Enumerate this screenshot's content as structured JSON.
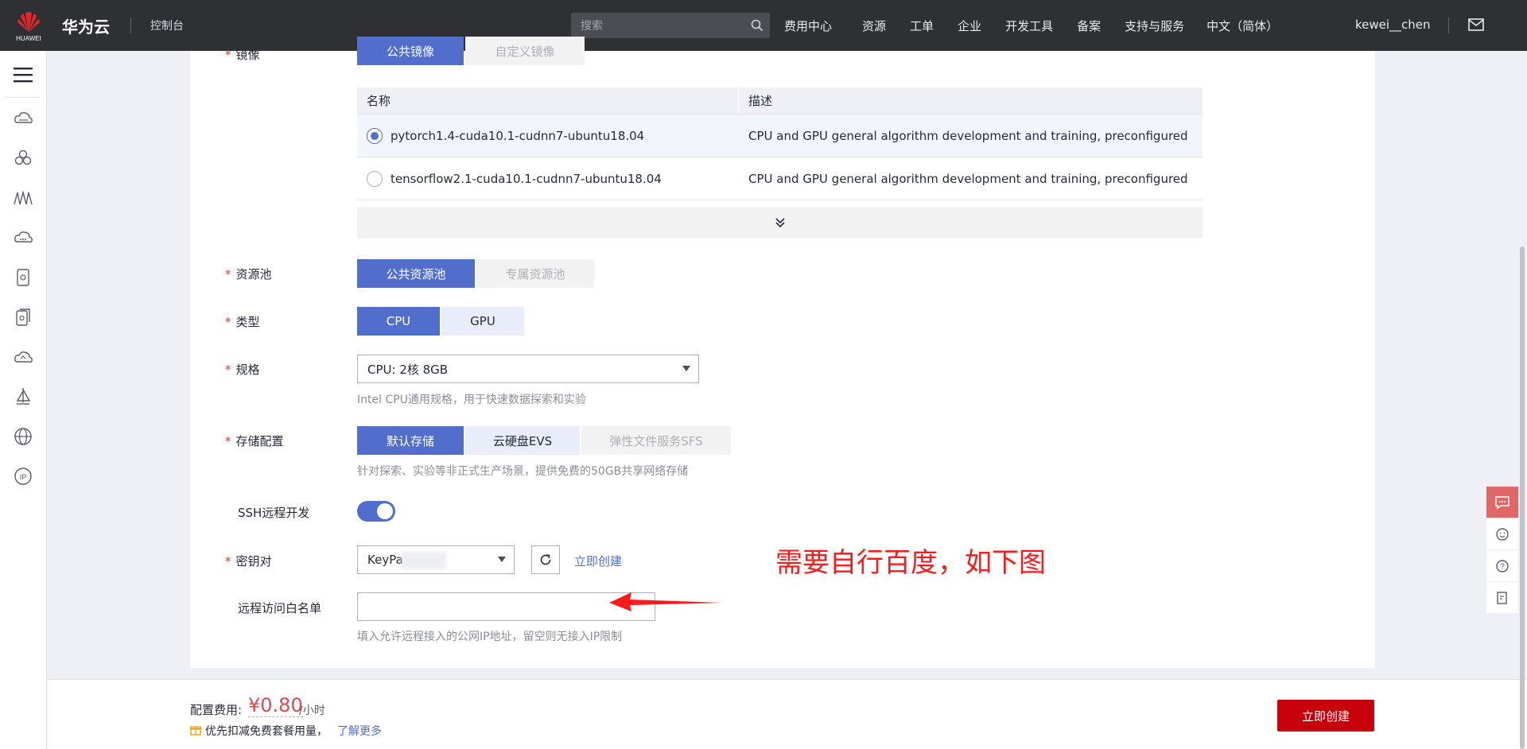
{
  "topbar": {
    "logo_text": "HUAWEI",
    "brand": "华为云",
    "console": "控制台",
    "search_placeholder": "搜索",
    "nav": [
      "费用中心",
      "资源",
      "工单",
      "企业",
      "开发工具",
      "备案",
      "支持与服务",
      "中文（简体）"
    ],
    "user": "kewei__chen"
  },
  "form": {
    "image_label": "镜像",
    "image_tabs": [
      "公共镜像",
      "自定义镜像"
    ],
    "table": {
      "headers": [
        "名称",
        "描述"
      ],
      "rows": [
        {
          "name": "pytorch1.4-cuda10.1-cudnn7-ubuntu18.04",
          "desc": "CPU and GPU general algorithm development and training, preconfigured with ...",
          "selected": true
        },
        {
          "name": "tensorflow2.1-cuda10.1-cudnn7-ubuntu18.04",
          "desc": "CPU and GPU general algorithm development and training, preconfigured with ...",
          "selected": false
        }
      ]
    },
    "pool_label": "资源池",
    "pool_options": [
      "公共资源池",
      "专属资源池"
    ],
    "type_label": "类型",
    "type_options": [
      "CPU",
      "GPU"
    ],
    "spec_label": "规格",
    "spec_value": "CPU: 2核 8GB",
    "spec_hint": "Intel CPU通用规格，用于快速数据探索和实验",
    "storage_label": "存储配置",
    "storage_options": [
      "默认存储",
      "云硬盘EVS",
      "弹性文件服务SFS"
    ],
    "storage_hint": "针对探索、实验等非正式生产场景，提供免费的50GB共享网络存储",
    "ssh_label": "SSH远程开发",
    "ssh_enabled": true,
    "keypair_label": "密钥对",
    "keypair_value": "KeyPa",
    "create_now_link": "立即创建",
    "whitelist_label": "远程访问白名单",
    "whitelist_value": "",
    "whitelist_hint": "填入允许远程接入的公网IP地址，留空则无接入IP限制"
  },
  "annotation": "需要自行百度，如下图",
  "footer": {
    "fee_label": "配置费用:",
    "price": "¥0.80",
    "unit": "/小时",
    "promo": "优先扣减免费套餐用量，",
    "promo_link": "了解更多",
    "create_button": "立即创建"
  },
  "colors": {
    "accent": "#526ecc",
    "brand_red": "#c7000b",
    "annotation_red": "#ff1a1a"
  }
}
